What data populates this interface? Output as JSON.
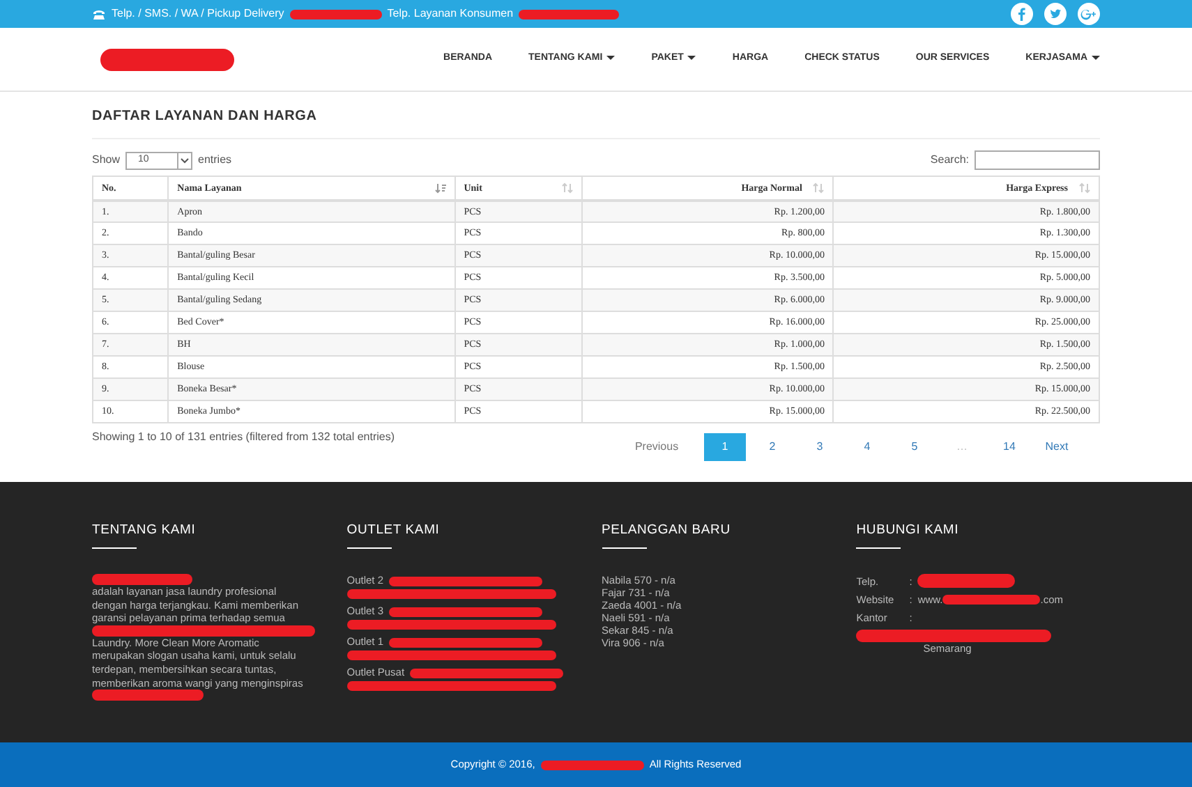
{
  "topbar": {
    "contact_label": "Telp. / SMS. / WA / Pickup Delivery",
    "consumer_label": "Telp. Layanan Konsumen"
  },
  "nav": [
    {
      "label": "BERANDA",
      "dropdown": false
    },
    {
      "label": "TENTANG KAMI",
      "dropdown": true
    },
    {
      "label": "PAKET",
      "dropdown": true
    },
    {
      "label": "HARGA",
      "dropdown": false
    },
    {
      "label": "CHECK STATUS",
      "dropdown": false
    },
    {
      "label": "OUR SERVICES",
      "dropdown": false
    },
    {
      "label": "KERJASAMA",
      "dropdown": true
    }
  ],
  "page_title": "DAFTAR LAYANAN DAN HARGA",
  "length_control": {
    "before": "Show",
    "value": "10",
    "after": "entries"
  },
  "search": {
    "label": "Search:"
  },
  "table": {
    "columns": [
      {
        "label": "No."
      },
      {
        "label": "Nama Layanan",
        "sorted": true
      },
      {
        "label": "Unit",
        "sorted": false
      },
      {
        "label": "Harga Normal",
        "sorted": false
      },
      {
        "label": "Harga Express",
        "sorted": false
      }
    ],
    "rows": [
      [
        "1.",
        "Apron",
        "PCS",
        "Rp. 1.200,00",
        "Rp. 1.800,00"
      ],
      [
        "2.",
        "Bando",
        "PCS",
        "Rp. 800,00",
        "Rp. 1.300,00"
      ],
      [
        "3.",
        "Bantal/guling Besar",
        "PCS",
        "Rp. 10.000,00",
        "Rp. 15.000,00"
      ],
      [
        "4.",
        "Bantal/guling Kecil",
        "PCS",
        "Rp. 3.500,00",
        "Rp. 5.000,00"
      ],
      [
        "5.",
        "Bantal/guling Sedang",
        "PCS",
        "Rp. 6.000,00",
        "Rp. 9.000,00"
      ],
      [
        "6.",
        "Bed Cover*",
        "PCS",
        "Rp. 16.000,00",
        "Rp. 25.000,00"
      ],
      [
        "7.",
        "BH",
        "PCS",
        "Rp. 1.000,00",
        "Rp. 1.500,00"
      ],
      [
        "8.",
        "Blouse",
        "PCS",
        "Rp. 1.500,00",
        "Rp. 2.500,00"
      ],
      [
        "9.",
        "Boneka Besar*",
        "PCS",
        "Rp. 10.000,00",
        "Rp. 15.000,00"
      ],
      [
        "10.",
        "Boneka Jumbo*",
        "PCS",
        "Rp. 15.000,00",
        "Rp. 22.500,00"
      ]
    ]
  },
  "table_info": "Showing 1 to 10 of 131 entries (filtered from 132 total entries)",
  "pagination": {
    "previous": "Previous",
    "pages": [
      {
        "label": "1",
        "selected": true
      },
      {
        "label": "2",
        "selected": false
      },
      {
        "label": "3",
        "selected": false
      },
      {
        "label": "4",
        "selected": false
      },
      {
        "label": "5",
        "selected": false
      },
      {
        "label": "…",
        "selected": false
      },
      {
        "label": "14",
        "selected": false
      }
    ],
    "next": "Next"
  },
  "footer": {
    "about": {
      "title": "TENTANG KAMI",
      "segments": [
        {
          "kind": "redaction"
        },
        {
          "kind": "text",
          "text": "adalah layanan jasa laundry profesional dengan harga terjangkau. Kami memberikan garansi pelayanan prima terhadap semua"
        },
        {
          "kind": "redaction"
        },
        {
          "kind": "text",
          "text": "Laundry. More Clean More Aromatic merupakan slogan usaha kami, untuk selalu terdepan, membersihkan secara tuntas, memberikan aroma wangi yang menginspiras"
        },
        {
          "kind": "redaction"
        }
      ]
    },
    "outlets": {
      "title": "OUTLET KAMI",
      "items": [
        "Outlet 2",
        "Outlet 3",
        "Outlet 1",
        "Outlet Pusat"
      ]
    },
    "customers": {
      "title": "PELANGGAN BARU",
      "items": [
        "Nabila 570 - n/a",
        "Fajar 731 - n/a",
        "Zaeda 4001 - n/a",
        "Naeli 591 - n/a",
        "Sekar 845 - n/a",
        "Vira 906 - n/a"
      ]
    },
    "contact": {
      "title": "HUBUNGI KAMI",
      "telp_label": "Telp.",
      "website_label": "Website",
      "website_prefix": "www.",
      "website_suffix": ".com",
      "office_label": "Kantor",
      "city": "Semarang",
      "separator": ":"
    }
  },
  "copyright": {
    "before": "Copyright © 2016,",
    "after": "All Rights Reserved"
  }
}
